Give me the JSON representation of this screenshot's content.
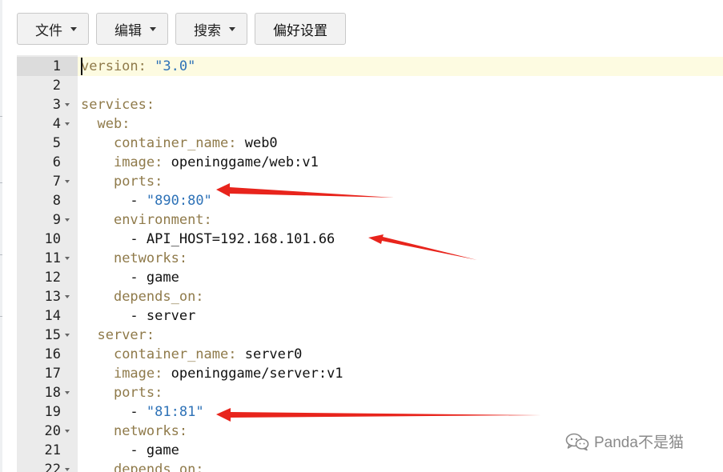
{
  "toolbar": {
    "file_label": "文件",
    "edit_label": "编辑",
    "search_label": "搜索",
    "prefs_label": "偏好设置"
  },
  "editor": {
    "lines": [
      {
        "n": "1",
        "indent": "",
        "key": "version:",
        "value": " \"3.0\"",
        "value_type": "str",
        "fold": false
      },
      {
        "n": "2",
        "indent": "",
        "key": "",
        "value": "",
        "value_type": "plain",
        "fold": false
      },
      {
        "n": "3",
        "indent": "",
        "key": "services:",
        "value": "",
        "value_type": "plain",
        "fold": true
      },
      {
        "n": "4",
        "indent": "  ",
        "key": "web:",
        "value": "",
        "value_type": "plain",
        "fold": true
      },
      {
        "n": "5",
        "indent": "    ",
        "key": "container_name:",
        "value": " web0",
        "value_type": "plain",
        "fold": false
      },
      {
        "n": "6",
        "indent": "    ",
        "key": "image:",
        "value": " openinggame/web:v1",
        "value_type": "plain",
        "fold": false
      },
      {
        "n": "7",
        "indent": "    ",
        "key": "ports:",
        "value": "",
        "value_type": "plain",
        "fold": true
      },
      {
        "n": "8",
        "indent": "      ",
        "key": "",
        "value": "- \"890:80\"",
        "value_type": "str-item",
        "fold": false
      },
      {
        "n": "9",
        "indent": "    ",
        "key": "environment:",
        "value": "",
        "value_type": "plain",
        "fold": true
      },
      {
        "n": "10",
        "indent": "      ",
        "key": "",
        "value": "- API_HOST=192.168.101.66",
        "value_type": "plain",
        "fold": false
      },
      {
        "n": "11",
        "indent": "    ",
        "key": "networks:",
        "value": "",
        "value_type": "plain",
        "fold": true
      },
      {
        "n": "12",
        "indent": "      ",
        "key": "",
        "value": "- game",
        "value_type": "plain",
        "fold": false
      },
      {
        "n": "13",
        "indent": "    ",
        "key": "depends_on:",
        "value": "",
        "value_type": "plain",
        "fold": true
      },
      {
        "n": "14",
        "indent": "      ",
        "key": "",
        "value": "- server",
        "value_type": "plain",
        "fold": false
      },
      {
        "n": "15",
        "indent": "  ",
        "key": "server:",
        "value": "",
        "value_type": "plain",
        "fold": true
      },
      {
        "n": "16",
        "indent": "    ",
        "key": "container_name:",
        "value": " server0",
        "value_type": "plain",
        "fold": false
      },
      {
        "n": "17",
        "indent": "    ",
        "key": "image:",
        "value": " openinggame/server:v1",
        "value_type": "plain",
        "fold": false
      },
      {
        "n": "18",
        "indent": "    ",
        "key": "ports:",
        "value": "",
        "value_type": "plain",
        "fold": true
      },
      {
        "n": "19",
        "indent": "      ",
        "key": "",
        "value": "- \"81:81\"",
        "value_type": "str-item",
        "fold": false
      },
      {
        "n": "20",
        "indent": "    ",
        "key": "networks:",
        "value": "",
        "value_type": "plain",
        "fold": true
      },
      {
        "n": "21",
        "indent": "      ",
        "key": "",
        "value": "- game",
        "value_type": "plain",
        "fold": false
      },
      {
        "n": "22",
        "indent": "    ",
        "key": "depends_on:",
        "value": "",
        "value_type": "plain",
        "fold": true
      }
    ]
  },
  "colors": {
    "key": "#8f7a4a",
    "string": "#2e72b7",
    "active_line": "#fdfbe1",
    "gutter": "#ebebeb",
    "arrow": "#e8241c"
  },
  "annotations": {
    "arrow_count": 3,
    "arrow_targets": [
      "890:80",
      "API_HOST=192.168.101.66",
      "81:81"
    ]
  },
  "watermark": {
    "text": "Panda不是猫",
    "icon": "wechat-icon"
  }
}
